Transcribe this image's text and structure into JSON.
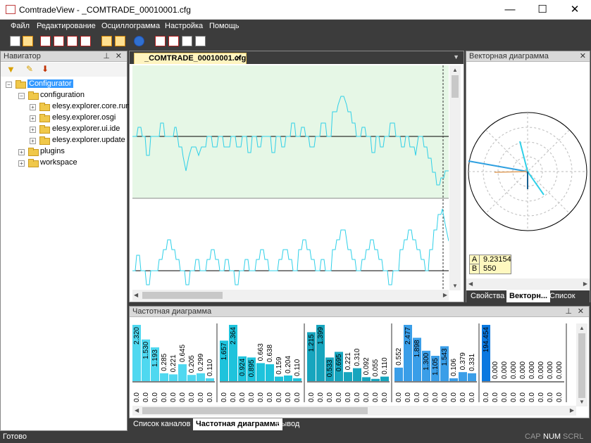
{
  "window": {
    "title": "ComtradeView - _COMTRADE_00010001.cfg",
    "minimize": "—",
    "maximize": "☐",
    "close": "✕"
  },
  "menu": [
    {
      "label": "Файл"
    },
    {
      "label": "Редактирование"
    },
    {
      "label": "Осциллограмма"
    },
    {
      "label": "Настройка"
    },
    {
      "label": "Помощь"
    }
  ],
  "navigator": {
    "title": "Навигатор",
    "tree": [
      {
        "label": "Configurator",
        "selected": true
      },
      {
        "label": "configuration"
      },
      {
        "label": "elesy.explorer.core.runtime"
      },
      {
        "label": "elesy.explorer.osgi"
      },
      {
        "label": "elesy.explorer.ui.ide"
      },
      {
        "label": "elesy.explorer.update"
      },
      {
        "label": "plugins"
      },
      {
        "label": "workspace"
      }
    ]
  },
  "document": {
    "tab": "_COMTRADE_00010001.cfg",
    "close": "✕"
  },
  "vector": {
    "title": "Векторная диаграмма",
    "legend": [
      {
        "key": "A",
        "value": "9.23154"
      },
      {
        "key": "B",
        "value": "550"
      }
    ],
    "tabs": [
      {
        "label": "Свойства"
      },
      {
        "label": "Векторн..."
      },
      {
        "label": "Список з..."
      }
    ]
  },
  "frequency": {
    "title": "Частотная диаграмма",
    "groups": [
      {
        "color": "#4fd8f0",
        "labels": [
          "2.320",
          "1.530",
          "1.193",
          "0.285",
          "0.221",
          "0.645",
          "0.205",
          "0.299",
          "0.110"
        ],
        "fracs": [
          1.0,
          0.74,
          0.6,
          0.14,
          0.12,
          0.3,
          0.11,
          0.14,
          0.05
        ]
      },
      {
        "color": "#1ec3dc",
        "labels": [
          "1.657",
          "2.364",
          "0.924",
          "0.895",
          "0.663",
          "0.638",
          "0.159",
          "0.204",
          "0.110"
        ],
        "fracs": [
          0.72,
          1.0,
          0.44,
          0.42,
          0.32,
          0.3,
          0.08,
          0.1,
          0.05
        ]
      },
      {
        "color": "#17a5be",
        "labels": [
          "1.215",
          "1.399",
          "0.533",
          "0.695",
          "0.221",
          "0.310",
          "0.092",
          "0.055",
          "0.110"
        ],
        "fracs": [
          0.87,
          1.0,
          0.42,
          0.52,
          0.16,
          0.23,
          0.07,
          0.04,
          0.08
        ]
      },
      {
        "color": "#3a9ee8",
        "labels": [
          "0.552",
          "2.477",
          "1.898",
          "1.300",
          "1.105",
          "1.543",
          "0.106",
          "0.379",
          "0.331"
        ],
        "fracs": [
          0.24,
          1.0,
          0.77,
          0.54,
          0.45,
          0.62,
          0.05,
          0.16,
          0.14
        ]
      },
      {
        "color": "#0a78e0",
        "labels": [
          "194.454",
          "0.000",
          "0.000",
          "0.000",
          "0.000",
          "0.000",
          "0.000",
          "0.000",
          "0.000"
        ],
        "fracs": [
          1.0,
          0,
          0,
          0,
          0,
          0,
          0,
          0,
          0
        ]
      },
      {
        "color": "#0a5ac8",
        "labels": [
          "194.454",
          "0.000",
          "0.000"
        ],
        "fracs": [
          1.0,
          0,
          0
        ]
      }
    ],
    "axis_label": "0.0"
  },
  "bottom_tabs": [
    {
      "label": "Список каналов"
    },
    {
      "label": "Частотная диаграмма"
    },
    {
      "label": "Вывод"
    }
  ],
  "status": {
    "text": "Готово",
    "cap": "CAP",
    "num": "NUM",
    "scrl": "SCRL"
  }
}
